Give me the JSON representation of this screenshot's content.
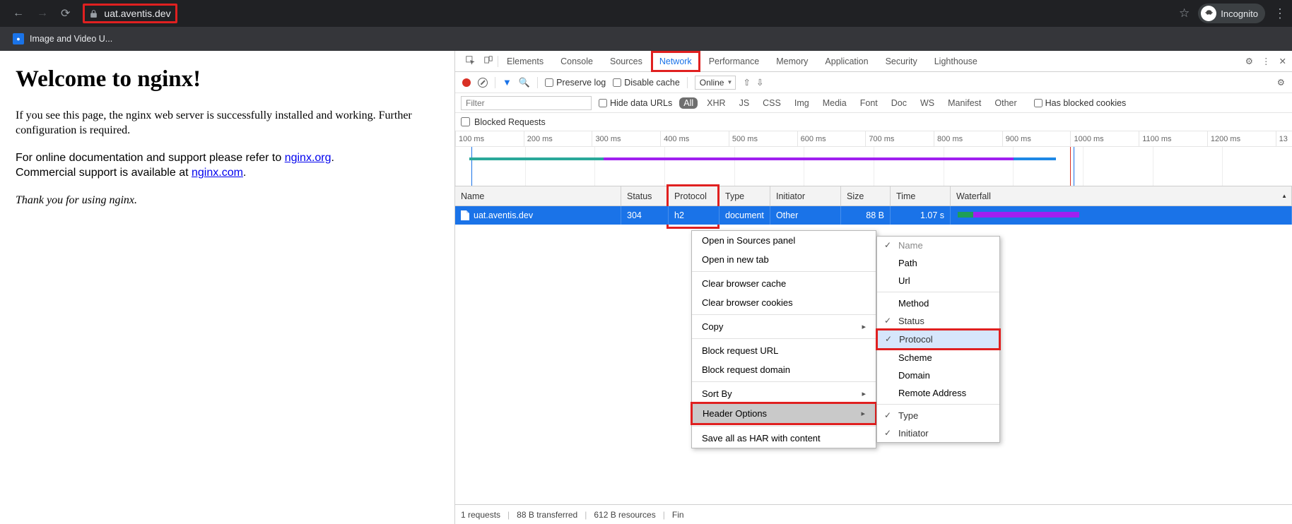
{
  "browser": {
    "url": "uat.aventis.dev",
    "incognito_label": "Incognito",
    "bookmark": "Image and Video U..."
  },
  "page": {
    "title": "Welcome to nginx!",
    "p1": "If you see this page, the nginx web server is successfully installed and working. Further configuration is required.",
    "p2a": "For online documentation and support please refer to ",
    "p2link1": "nginx.org",
    "p2b": ".",
    "p3a": "Commercial support is available at ",
    "p3link2": "nginx.com",
    "p3b": ".",
    "thanks": "Thank you for using nginx."
  },
  "devtools": {
    "tabs": [
      "Elements",
      "Console",
      "Sources",
      "Network",
      "Performance",
      "Memory",
      "Application",
      "Security",
      "Lighthouse"
    ],
    "toolbar": {
      "preserve": "Preserve log",
      "disable": "Disable cache",
      "online": "Online"
    },
    "filter_placeholder": "Filter",
    "hide_urls": "Hide data URLs",
    "types": [
      "All",
      "XHR",
      "JS",
      "CSS",
      "Img",
      "Media",
      "Font",
      "Doc",
      "WS",
      "Manifest",
      "Other"
    ],
    "blocked_cookies": "Has blocked cookies",
    "blocked_requests": "Blocked Requests",
    "ticks": [
      "100 ms",
      "200 ms",
      "300 ms",
      "400 ms",
      "500 ms",
      "600 ms",
      "700 ms",
      "800 ms",
      "900 ms",
      "1000 ms",
      "1100 ms",
      "1200 ms",
      "13"
    ],
    "columns": {
      "name": "Name",
      "status": "Status",
      "protocol": "Protocol",
      "type": "Type",
      "initiator": "Initiator",
      "size": "Size",
      "time": "Time",
      "waterfall": "Waterfall"
    },
    "row": {
      "name": "uat.aventis.dev",
      "status": "304",
      "protocol": "h2",
      "type": "document",
      "initiator": "Other",
      "size": "88 B",
      "time": "1.07 s"
    },
    "context_menu": {
      "open_sources": "Open in Sources panel",
      "open_tab": "Open in new tab",
      "clear_cache": "Clear browser cache",
      "clear_cookies": "Clear browser cookies",
      "copy": "Copy",
      "block_url": "Block request URL",
      "block_domain": "Block request domain",
      "sort_by": "Sort By",
      "header_opts": "Header Options",
      "save_har": "Save all as HAR with content"
    },
    "col_menu": {
      "name": "Name",
      "path": "Path",
      "url": "Url",
      "method": "Method",
      "status": "Status",
      "protocol": "Protocol",
      "scheme": "Scheme",
      "domain": "Domain",
      "remote": "Remote Address",
      "type": "Type",
      "initiator": "Initiator"
    },
    "status_bar": {
      "req": "1 requests",
      "xfer": "88 B transferred",
      "res": "612 B resources",
      "fin": "Fin"
    }
  }
}
